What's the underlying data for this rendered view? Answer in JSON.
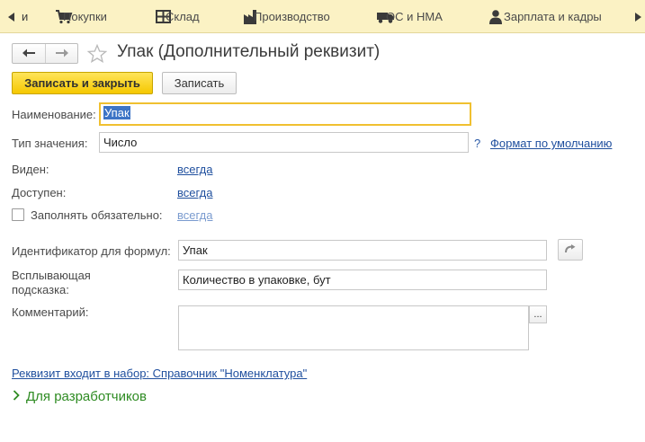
{
  "sections": {
    "truncated_label": "и",
    "items": [
      {
        "label": "Покупки",
        "icon": "cart-icon"
      },
      {
        "label": "Склад",
        "icon": "warehouse-icon"
      },
      {
        "label": "Производство",
        "icon": "factory-icon"
      },
      {
        "label": "ОС и НМА",
        "icon": "truck-icon"
      },
      {
        "label": "Зарплата и кадры",
        "icon": "person-icon"
      }
    ]
  },
  "window": {
    "title": "Упак (Дополнительный реквизит)"
  },
  "toolbar": {
    "save_close_label": "Записать и закрыть",
    "save_label": "Записать"
  },
  "form": {
    "name_label": "Наименование:",
    "name_value": "Упак",
    "type_label": "Тип значения:",
    "type_value": "Число",
    "help_mark": "?",
    "format_link": "Формат по умолчанию",
    "visible_label": "Виден:",
    "visible_value": "всегда",
    "available_label": "Доступен:",
    "available_value": "всегда",
    "required_label": "Заполнять обязательно:",
    "required_checked": false,
    "required_value": "всегда",
    "formula_id_label": "Идентификатор для формул:",
    "formula_id_value": "Упак",
    "tooltip_label_line1": "Всплывающая",
    "tooltip_label_line2": "подсказка:",
    "tooltip_value": "Количество в упаковке, бут",
    "comment_label": "Комментарий:",
    "comment_value": "",
    "comment_button": "...",
    "set_link": "Реквизит входит в набор: Справочник \"Номенклатура\"",
    "dev_group_label": "Для разработчиков"
  },
  "colors": {
    "section_bar": "#fbf2c4",
    "primary_button": "#f5c800",
    "link": "#1f4f9e",
    "group_header": "#2e8b22",
    "focus_border": "#f0c030"
  }
}
